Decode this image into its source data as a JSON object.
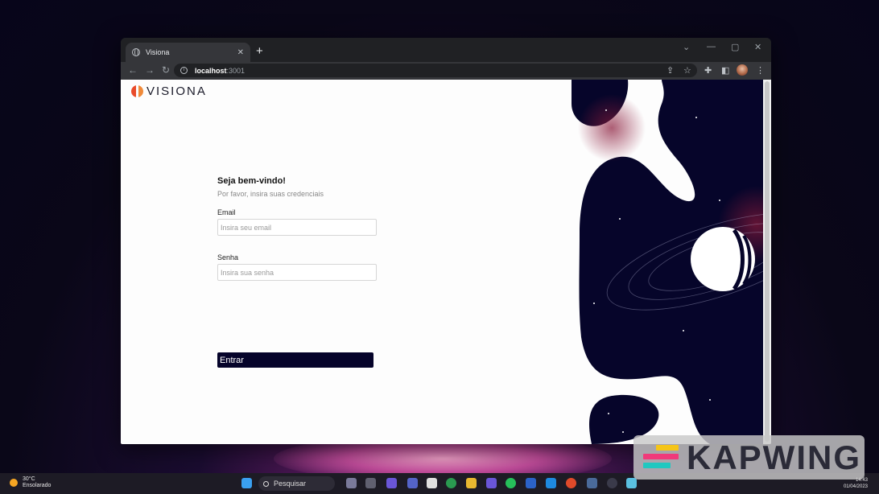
{
  "browser": {
    "tab_title": "Visiona",
    "tab_close": "✕",
    "new_tab": "+",
    "url_host": "localhost",
    "url_port": ":3001"
  },
  "page": {
    "logo_text": "VISIONA",
    "title": "Seja bem-vindo!",
    "subtitle": "Por favor, insira suas credenciais",
    "email_label": "Email",
    "email_placeholder": "Insira seu email",
    "password_label": "Senha",
    "password_placeholder": "Insira sua senha",
    "submit_label": "Entrar"
  },
  "taskbar": {
    "weather_temp": "30°C",
    "weather_desc": "Ensolarado",
    "search_label": "Pesquisar",
    "time": "14:43",
    "date": "01/04/2023"
  },
  "watermark": {
    "text": "KAPWING"
  },
  "colors": {
    "button_bg": "#05032a",
    "space_bg": "#07052a",
    "logo_accent": "#e94b2a"
  }
}
